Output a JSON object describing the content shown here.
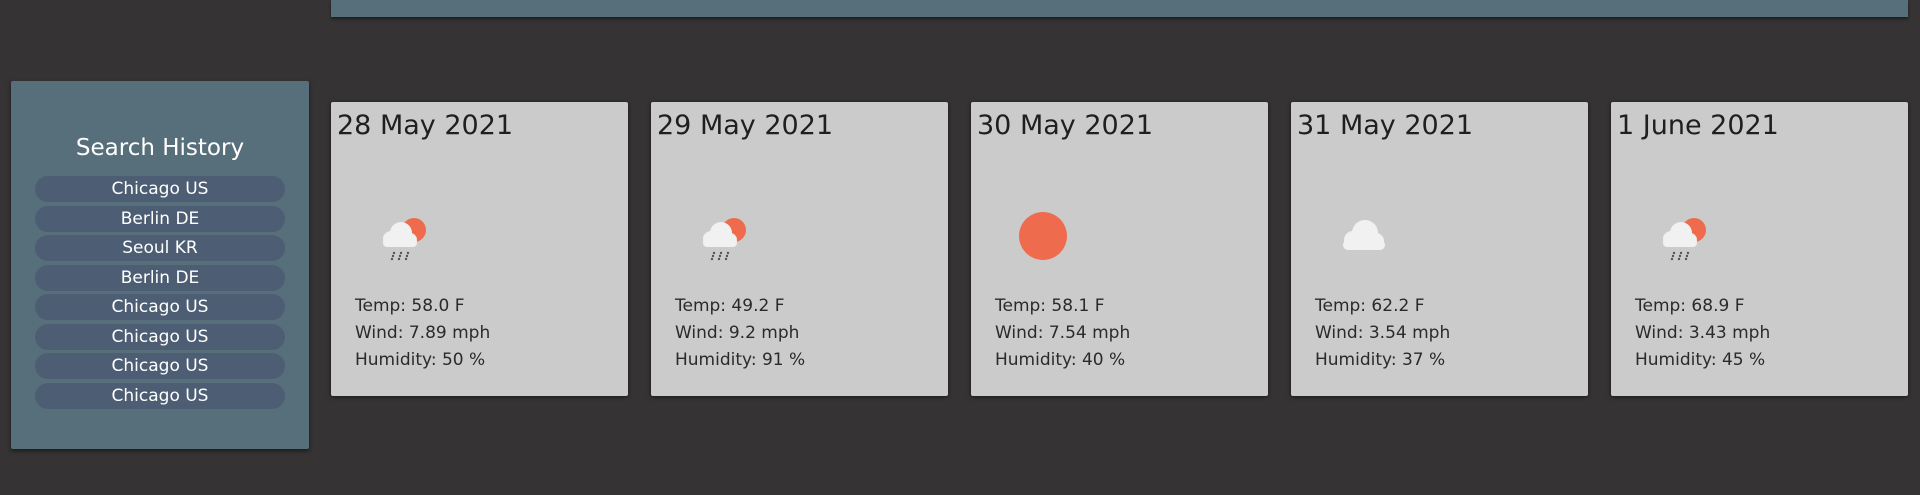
{
  "sidebar": {
    "title": "Search History",
    "items": [
      {
        "label": "Chicago US"
      },
      {
        "label": "Berlin DE"
      },
      {
        "label": "Seoul KR"
      },
      {
        "label": "Berlin DE"
      },
      {
        "label": "Chicago US"
      },
      {
        "label": "Chicago US"
      },
      {
        "label": "Chicago US"
      },
      {
        "label": "Chicago US"
      }
    ]
  },
  "forecast": [
    {
      "date": "28 May 2021",
      "icon": "rain-sun-icon",
      "temp": "Temp: 58.0 F",
      "wind": "Wind: 7.89 mph",
      "humidity": "Humidity: 50 %"
    },
    {
      "date": "29 May 2021",
      "icon": "rain-sun-icon",
      "temp": "Temp: 49.2 F",
      "wind": "Wind: 9.2 mph",
      "humidity": "Humidity: 91 %"
    },
    {
      "date": "30 May 2021",
      "icon": "sun-icon",
      "temp": "Temp: 58.1 F",
      "wind": "Wind: 7.54 mph",
      "humidity": "Humidity: 40 %"
    },
    {
      "date": "31 May 2021",
      "icon": "cloud-icon",
      "temp": "Temp: 62.2 F",
      "wind": "Wind: 3.54 mph",
      "humidity": "Humidity: 37 %"
    },
    {
      "date": "1 June 2021",
      "icon": "rain-sun-icon",
      "temp": "Temp: 68.9 F",
      "wind": "Wind: 3.43 mph",
      "humidity": "Humidity: 45 %"
    }
  ],
  "colors": {
    "background": "#353334",
    "panel": "#566f7b",
    "history_button": "#4d5e74",
    "card": "#cbcbcb",
    "sun": "#ee6c4d",
    "cloud": "#f1f1f1"
  }
}
